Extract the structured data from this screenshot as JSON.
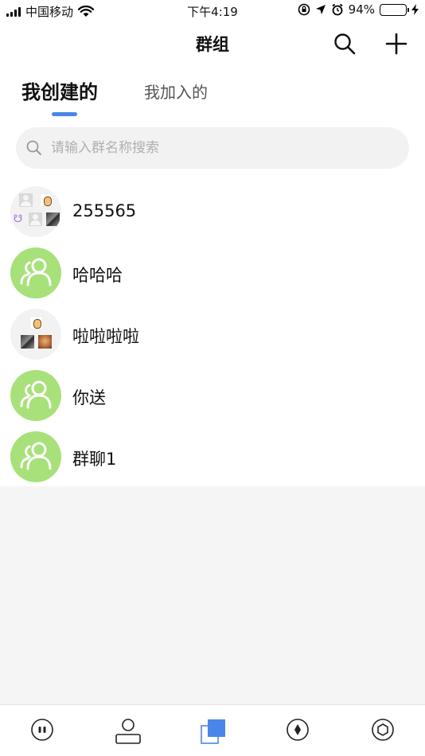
{
  "status_bar": {
    "carrier": "中国移动",
    "time": "下午4:19",
    "battery_percent": "94%",
    "battery_level": 0.94
  },
  "header": {
    "title": "群组"
  },
  "tabs": [
    {
      "label": "我创建的",
      "active": true
    },
    {
      "label": "我加入的",
      "active": false
    }
  ],
  "search": {
    "placeholder": "请输入群名称搜索",
    "value": ""
  },
  "groups": [
    {
      "name": "255565",
      "avatar": "grid-avatar"
    },
    {
      "name": "哈哈哈",
      "avatar": "group-people-icon"
    },
    {
      "name": "啦啦啦啦",
      "avatar": "grid-avatar"
    },
    {
      "name": "你送",
      "avatar": "group-people-icon"
    },
    {
      "name": "群聊1",
      "avatar": "group-people-icon"
    }
  ],
  "bottom_tabs": [
    {
      "icon": "chat-bubble-icon",
      "active": false
    },
    {
      "icon": "contacts-icon",
      "active": false
    },
    {
      "icon": "groups-icon",
      "active": true
    },
    {
      "icon": "compass-icon",
      "active": false
    },
    {
      "icon": "settings-hexagon-icon",
      "active": false
    }
  ],
  "colors": {
    "accent": "#4a86e8",
    "avatar_green": "#a8e07a",
    "battery_green": "#4cd964",
    "page_background": "#f5f5f5"
  }
}
